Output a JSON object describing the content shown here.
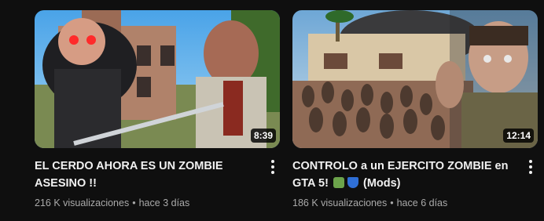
{
  "videos": [
    {
      "title": "EL CERDO AHORA ES UN ZOMBIE ASESINO !!",
      "duration": "8:39",
      "views": "216 K visualizaciones",
      "age": "hace 3 días",
      "menu_icon": "more-vert-icon"
    },
    {
      "title_before": "CONTROLO a un EJERCITO ZOMBIE en GTA 5!",
      "title_emojis": [
        "zombie-emoji",
        "shield-emoji"
      ],
      "title_after": "(Mods)",
      "duration": "12:14",
      "views": "186 K visualizaciones",
      "age": "hace 6 días",
      "menu_icon": "more-vert-icon"
    }
  ],
  "separator": "•",
  "colors": {
    "background": "#0f0f0f",
    "title": "#f1f1f1",
    "meta": "#aaaaaa",
    "duration_bg": "#000000"
  }
}
